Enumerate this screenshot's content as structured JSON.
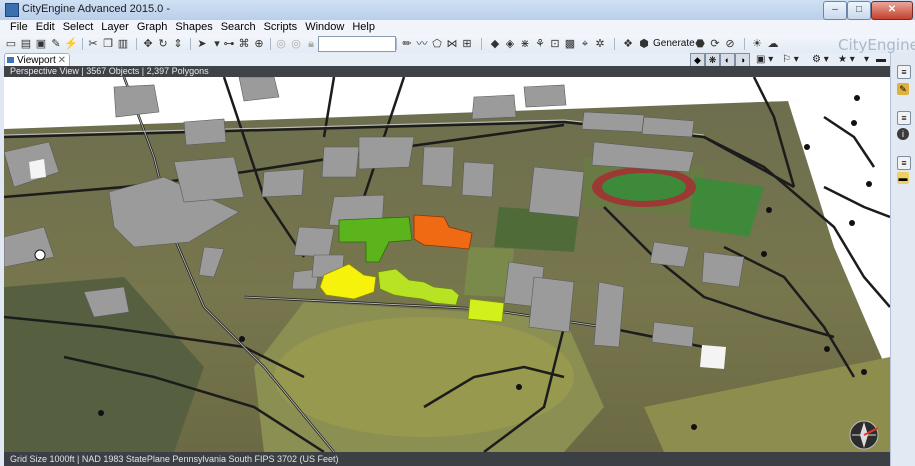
{
  "window": {
    "title": "CityEngine Advanced 2015.0 -",
    "controls": {
      "minimize": "–",
      "maximize": "□",
      "close": "✕"
    }
  },
  "menu": [
    "File",
    "Edit",
    "Select",
    "Layer",
    "Graph",
    "Shapes",
    "Search",
    "Scripts",
    "Window",
    "Help"
  ],
  "toolbar": {
    "search_value": "",
    "generate_label": "Generate",
    "brand": "CityEngine",
    "icons": [
      "new-icon",
      "open-icon",
      "save-icon",
      "cut-icon",
      "move-icon",
      "rotate-icon",
      "scale-icon",
      "select-icon",
      "zoom-icon",
      "camera-icon",
      "lock-icon",
      "brush-icon",
      "shape-icon",
      "graph-icon",
      "generate-icon",
      "sun-icon",
      "cloud-icon"
    ]
  },
  "viewport": {
    "tab_label": "Viewport",
    "tab_close": "✕",
    "info": "Perspective View  |  3567 Objects  |  2,397 Polygons",
    "status": "Grid Size 1000ft  |  NAD 1983 StatePlane Pennsylvania South FIPS 3702 (US Feet)",
    "compass": "N"
  },
  "colors": {
    "accent_green": "#5cb41c",
    "accent_orange": "#f06a14",
    "accent_yellow": "#f6f20c",
    "accent_yellowgreen": "#b8e224",
    "lime": "#d2f01c",
    "building_gray": "#9a9a9a",
    "terrain": "#6f6c4a"
  },
  "right_panel": [
    "layers-icon",
    "info-icon",
    "inspector-icon",
    "folder-icon"
  ]
}
